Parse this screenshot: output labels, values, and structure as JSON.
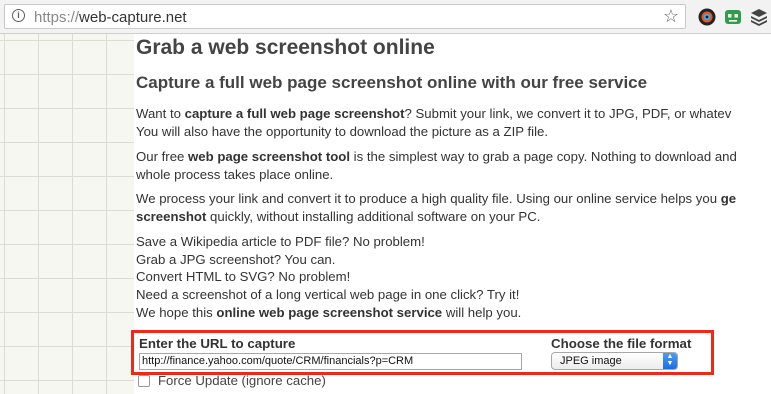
{
  "browser": {
    "url_scheme": "https://",
    "url_host": "web-capture.net",
    "icons": [
      "info-icon",
      "star-icon",
      "camera-extension-icon",
      "robot-extension-icon",
      "layers-extension-icon"
    ]
  },
  "page": {
    "title": "Grab a web screenshot online",
    "subtitle": "Capture a full web page screenshot online with our free service",
    "p1": {
      "l1_a": "Want to ",
      "l1_b": "capture a full web page screenshot",
      "l1_c": "? Submit your link, we convert it to JPG, PDF, or whatev",
      "l2": "You will also have the opportunity to download the picture as a ZIP file."
    },
    "p2": {
      "l1_a": "Our free ",
      "l1_b": "web page screenshot tool",
      "l1_c": " is the simplest way to grab a page copy. Nothing to download and",
      "l2": "whole process takes place online."
    },
    "p3": {
      "l1_a": "We process your link and convert it to produce a high quality file. Using our online service helps you ",
      "l1_b": "ge",
      "l2_b": "screenshot",
      "l2_c": " quickly, without installing additional software on your PC."
    },
    "p4": {
      "l1": "Save a Wikipedia article to PDF file? No problem!",
      "l2": "Grab a JPG screenshot? You can.",
      "l3": "Convert HTML to SVG? No problem!",
      "l4": "Need a screenshot of a long vertical web page in one click? Try it!"
    },
    "p5": {
      "a": "We hope this ",
      "b": "online web page screenshot service",
      "c": " will help you."
    }
  },
  "form": {
    "url_label": "Enter the URL to capture",
    "url_value": "http://finance.yahoo.com/quote/CRM/financials?p=CRM",
    "format_label": "Choose the file format",
    "format_value": "JPEG image",
    "force_update_label": "Force Update (ignore cache)",
    "highlight_color": "#ec2a1c"
  }
}
